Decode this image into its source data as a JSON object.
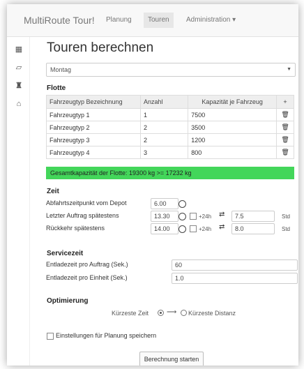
{
  "navbar": {
    "brand": "MultiRoute Tour!",
    "items": [
      "Planung",
      "Touren",
      "Administration ▾"
    ]
  },
  "sidebar": {
    "icons": [
      "calculator-icon",
      "folder-open-icon",
      "binoculars-icon",
      "home-icon"
    ]
  },
  "page": {
    "title": "Touren berechnen",
    "day_select": "Montag"
  },
  "flotte": {
    "heading": "Flotte",
    "headers": [
      "Fahrzeugtyp Bezeichnung",
      "Anzahl",
      "Kapazität je Fahrzeug",
      "+"
    ],
    "rows": [
      {
        "name": "Fahrzeugtyp 1",
        "count": "1",
        "capacity": "7500"
      },
      {
        "name": "Fahrzeugtyp 2",
        "count": "2",
        "capacity": "3500"
      },
      {
        "name": "Fahrzeugtyp 3",
        "count": "2",
        "capacity": "1200"
      },
      {
        "name": "Fahrzeugtyp 4",
        "count": "3",
        "capacity": "800"
      }
    ],
    "summary": "Gesamtkapazität der Flotte: 19300 kg >= 17232 kg"
  },
  "zeit": {
    "heading": "Zeit",
    "abfahrt_label": "Abfahrtszeitpunkt vom Depot",
    "abfahrt_value": "6.00",
    "letzter_label": "Letzter Auftrag spätestens",
    "letzter_value": "13.30",
    "letzter_std": "7.5",
    "rueckkehr_label": "Rückkehr spätestens",
    "rueckkehr_value": "14.00",
    "rueckkehr_std": "8.0",
    "plus24": "+24h",
    "std": "Std"
  },
  "service": {
    "heading": "Servicezeit",
    "auftrag_label": "Entladezeit pro Auftrag (Sek.)",
    "auftrag_value": "60",
    "einheit_label": "Entladezeit pro Einheit (Sek.)",
    "einheit_value": "1.0"
  },
  "optimierung": {
    "heading": "Optimierung",
    "option_a": "Kürzeste Zeit",
    "option_b": "Kürzeste Distanz",
    "selected": "Kürzeste Zeit"
  },
  "save_label": "Einstellungen für Planung speichern",
  "button_label": "Berechnung starten"
}
